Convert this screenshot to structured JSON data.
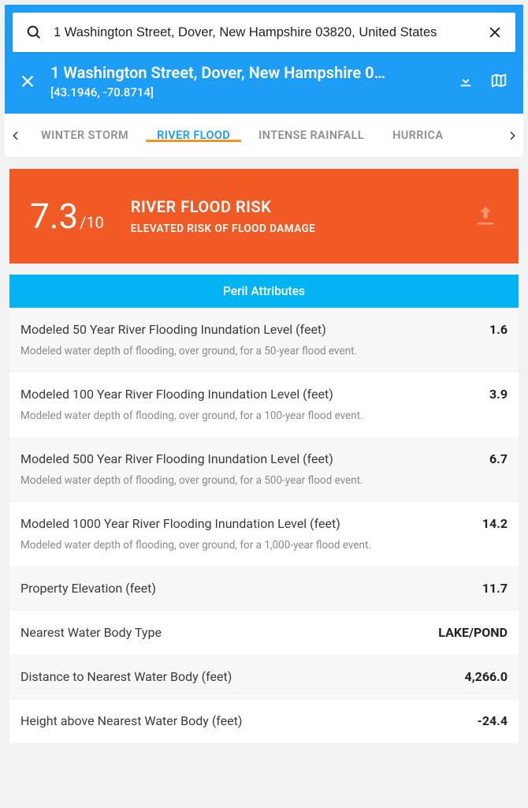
{
  "search": {
    "value": "1 Washington Street, Dover, New Hampshire 03820, United States"
  },
  "address": {
    "title": "1 Washington Street, Dover, New Hampshire 0…",
    "coords": "[43.1946, -70.8714]"
  },
  "tabs": {
    "items": [
      {
        "label": "WINTER STORM",
        "active": false
      },
      {
        "label": "RIVER FLOOD",
        "active": true
      },
      {
        "label": "INTENSE RAINFALL",
        "active": false
      },
      {
        "label": "HURRICA",
        "active": false
      }
    ]
  },
  "risk": {
    "score": "7.3",
    "denominator": "/10",
    "title": "RIVER FLOOD RISK",
    "subtitle": "ELEVATED RISK OF FLOOD DAMAGE"
  },
  "section_header": "Peril Attributes",
  "attributes": [
    {
      "label": "Modeled 50 Year River Flooding Inundation Level (feet)",
      "value": "1.6",
      "desc": "Modeled water depth of flooding, over ground, for a 50-year flood event."
    },
    {
      "label": "Modeled 100 Year River Flooding Inundation Level (feet)",
      "value": "3.9",
      "desc": "Modeled water depth of flooding, over ground, for a 100-year flood event."
    },
    {
      "label": "Modeled 500 Year River Flooding Inundation Level (feet)",
      "value": "6.7",
      "desc": "Modeled water depth of flooding, over ground, for a 500-year flood event."
    },
    {
      "label": "Modeled 1000 Year River Flooding Inundation Level (feet)",
      "value": "14.2",
      "desc": "Modeled water depth of flooding, over ground, for a 1,000-year flood event."
    },
    {
      "label": "Property Elevation (feet)",
      "value": "11.7",
      "desc": ""
    },
    {
      "label": "Nearest Water Body Type",
      "value": "LAKE/POND",
      "desc": ""
    },
    {
      "label": "Distance to Nearest Water Body (feet)",
      "value": "4,266.0",
      "desc": ""
    },
    {
      "label": "Height above Nearest Water Body (feet)",
      "value": "-24.4",
      "desc": ""
    }
  ]
}
